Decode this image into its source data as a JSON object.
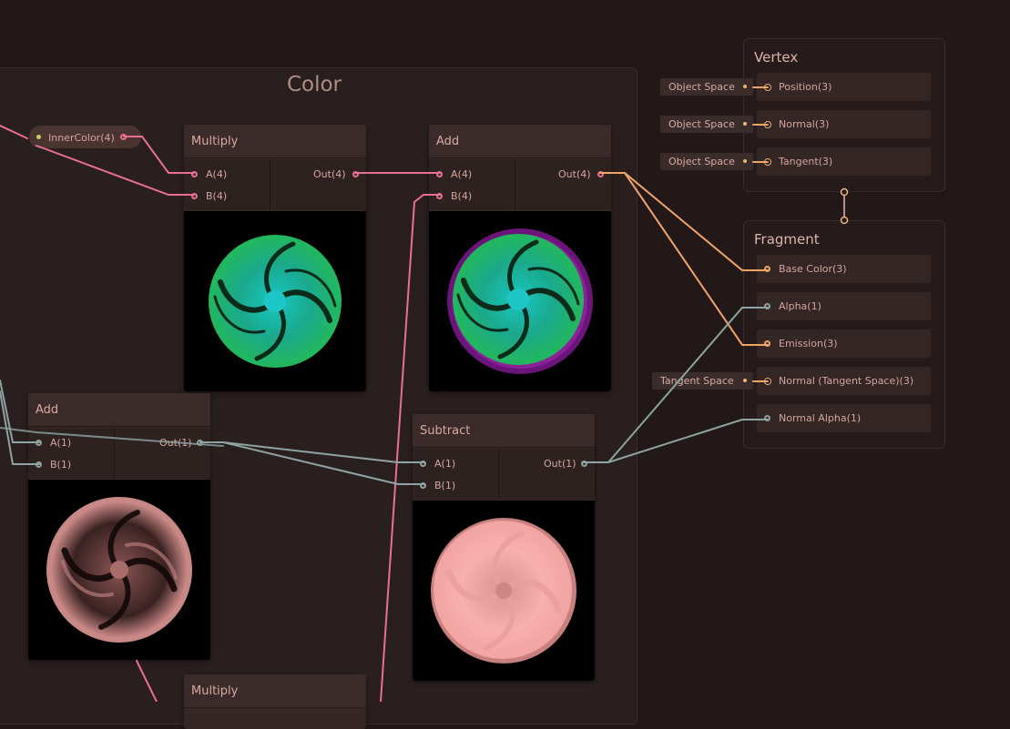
{
  "group": {
    "title": "Color"
  },
  "property_node": {
    "label": "InnerColor(4)"
  },
  "nodes": {
    "multiply_top": {
      "title": "Multiply",
      "inputs": [
        "A(4)",
        "B(4)"
      ],
      "output": "Out(4)"
    },
    "add_top": {
      "title": "Add",
      "inputs": [
        "A(4)",
        "B(4)"
      ],
      "output": "Out(4)"
    },
    "add_left": {
      "title": "Add",
      "inputs": [
        "A(1)",
        "B(1)"
      ],
      "output": "Out(1)"
    },
    "subtract": {
      "title": "Subtract",
      "inputs": [
        "A(1)",
        "B(1)"
      ],
      "output": "Out(1)"
    },
    "multiply_bottom": {
      "title": "Multiply"
    }
  },
  "vertex": {
    "title": "Vertex",
    "slots": [
      {
        "label": "Position(3)",
        "tag": "Object Space"
      },
      {
        "label": "Normal(3)",
        "tag": "Object Space"
      },
      {
        "label": "Tangent(3)",
        "tag": "Object Space"
      }
    ]
  },
  "fragment": {
    "title": "Fragment",
    "slots": [
      {
        "label": "Base Color(3)"
      },
      {
        "label": "Alpha(1)"
      },
      {
        "label": "Emission(3)"
      },
      {
        "label": "Normal (Tangent Space)(3)",
        "tag": "Tangent Space"
      },
      {
        "label": "Normal Alpha(1)"
      }
    ]
  },
  "colors": {
    "background": "#221818",
    "wire_color": "#e86f95",
    "wire_float": "#8ea4a2",
    "wire_orange": "#f0a466",
    "preview_green": "#27b864",
    "preview_pink": "#f3a6a4",
    "preview_purple": "#7c1a8c"
  }
}
